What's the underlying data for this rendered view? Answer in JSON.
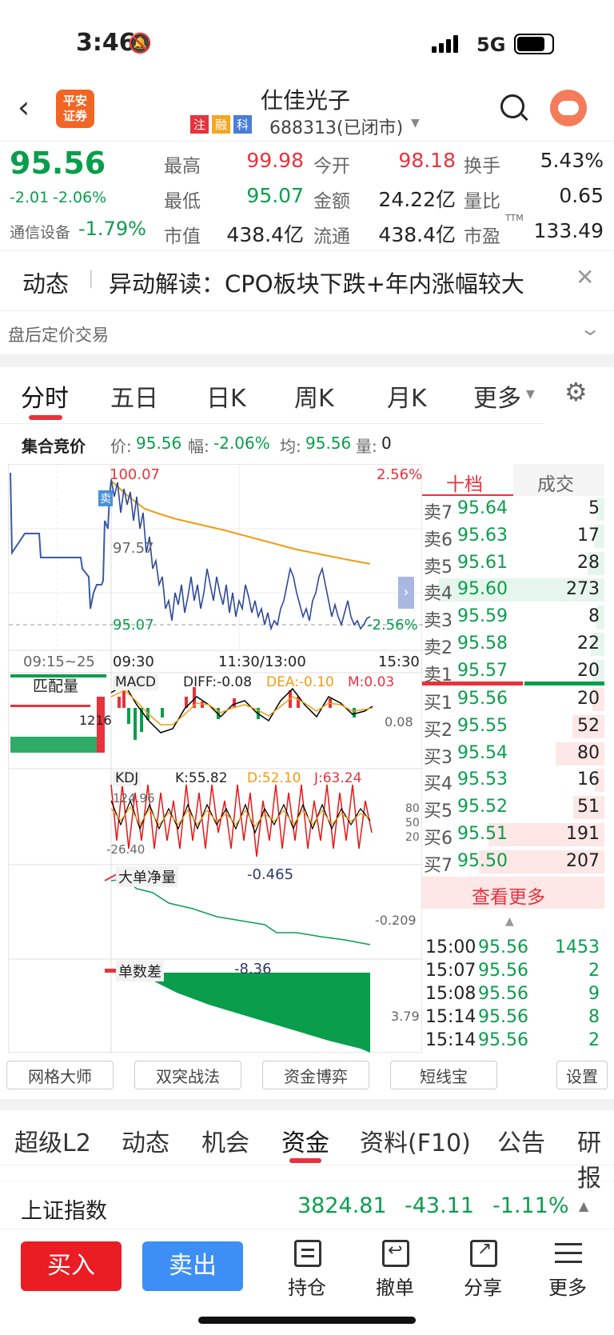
{
  "status": {
    "time": "3:46",
    "network": "5G"
  },
  "header": {
    "title": "仕佳光子",
    "code": "688313(已闭市)",
    "badges": [
      "注",
      "融",
      "科"
    ],
    "logo": "平安\n证券"
  },
  "quote": {
    "price": "95.56",
    "change": "-2.01",
    "change_pct": "-2.06%",
    "sector_name": "通信设备",
    "sector_change": "-1.79%",
    "rows": [
      [
        "最高",
        "99.98",
        "今开",
        "98.18",
        "换手",
        "5.43%"
      ],
      [
        "最低",
        "95.07",
        "金额",
        "24.22亿",
        "量比",
        "0.65"
      ],
      [
        "市值",
        "438.4亿",
        "流通",
        "438.4亿",
        "市盈",
        "133.49"
      ]
    ],
    "pe_sup": "TTM"
  },
  "news": {
    "tag": "动态",
    "text": "异动解读：CPO板块下跌+年内涨幅较大"
  },
  "after_hours": "盘后定价交易",
  "chart_tabs": [
    "分时",
    "五日",
    "日K",
    "周K",
    "月K",
    "更多"
  ],
  "auction": {
    "label": "集合竞价",
    "price_label": "价:",
    "price": "95.56",
    "pct_label": "幅:",
    "pct": "-2.06%",
    "avg_label": "均:",
    "avg": "95.56",
    "vol_label": "量:",
    "vol": "0"
  },
  "chart": {
    "hi_price": "100.07",
    "hi_pct": "2.56%",
    "mid_price": "97.57",
    "lo_price": "95.07",
    "lo_pct": "-2.56%",
    "time_left": "09:15~25",
    "time_open": "09:30",
    "time_mid": "11:30/13:00",
    "time_close": "15:30",
    "sell_tag": "卖",
    "match_label": "匹配量",
    "match_val": "1216",
    "macd_label": "MACD",
    "diff": "DIFF:-0.08",
    "dea": "DEA:-0.10",
    "m": "M:0.03",
    "macd_right": "0.08",
    "kdj_label": "KDJ",
    "k": "K:55.82",
    "d": "D:52.10",
    "j": "J:63.24",
    "kdj_hi": "124.96",
    "kdj_lo": "-26.40",
    "kdj_levels": [
      "80",
      "50",
      "20"
    ],
    "big_label": "大单净量",
    "big_val": "-0.465",
    "big_right": "-0.209",
    "diff_label": "单数差",
    "diff_val": "-8.36",
    "diff_right": "3.79"
  },
  "orderbook": {
    "tabs": [
      "十档",
      "成交"
    ],
    "asks": [
      [
        "卖7",
        "95.64",
        "5"
      ],
      [
        "卖6",
        "95.63",
        "17"
      ],
      [
        "卖5",
        "95.61",
        "28"
      ],
      [
        "卖4",
        "95.60",
        "273"
      ],
      [
        "卖3",
        "95.59",
        "8"
      ],
      [
        "卖2",
        "95.58",
        "22"
      ],
      [
        "卖1",
        "95.57",
        "20"
      ]
    ],
    "bids": [
      [
        "买1",
        "95.56",
        "20"
      ],
      [
        "买2",
        "95.55",
        "52"
      ],
      [
        "买3",
        "95.54",
        "80"
      ],
      [
        "买4",
        "95.53",
        "16"
      ],
      [
        "买5",
        "95.52",
        "51"
      ],
      [
        "买6",
        "95.51",
        "191"
      ],
      [
        "买7",
        "95.50",
        "207"
      ]
    ],
    "more": "查看更多",
    "trades": [
      [
        "15:00",
        "95.56",
        "1453"
      ],
      [
        "15:07",
        "95.56",
        "2"
      ],
      [
        "15:08",
        "95.56",
        "9"
      ],
      [
        "15:14",
        "95.56",
        "8"
      ],
      [
        "15:14",
        "95.56",
        "2"
      ]
    ]
  },
  "tools": [
    "网格大师",
    "双突战法",
    "资金博弈",
    "短线宝",
    "设置"
  ],
  "bottom_tabs": [
    "超级L2",
    "动态",
    "机会",
    "资金",
    "资料(F10)",
    "公告",
    "研报"
  ],
  "index": {
    "name": "上证指数",
    "value": "3824.81",
    "change": "-43.11",
    "pct": "-1.11%"
  },
  "actions": {
    "buy": "买入",
    "sell": "卖出",
    "hold": "持仓",
    "cancel": "撤单",
    "share": "分享",
    "more": "更多"
  },
  "colors": {
    "up": "#e8323c",
    "down": "#0a9e4c",
    "accent": "#e8323c",
    "buy_btn": "#ea1c24",
    "sell_btn": "#3d8ef5"
  }
}
